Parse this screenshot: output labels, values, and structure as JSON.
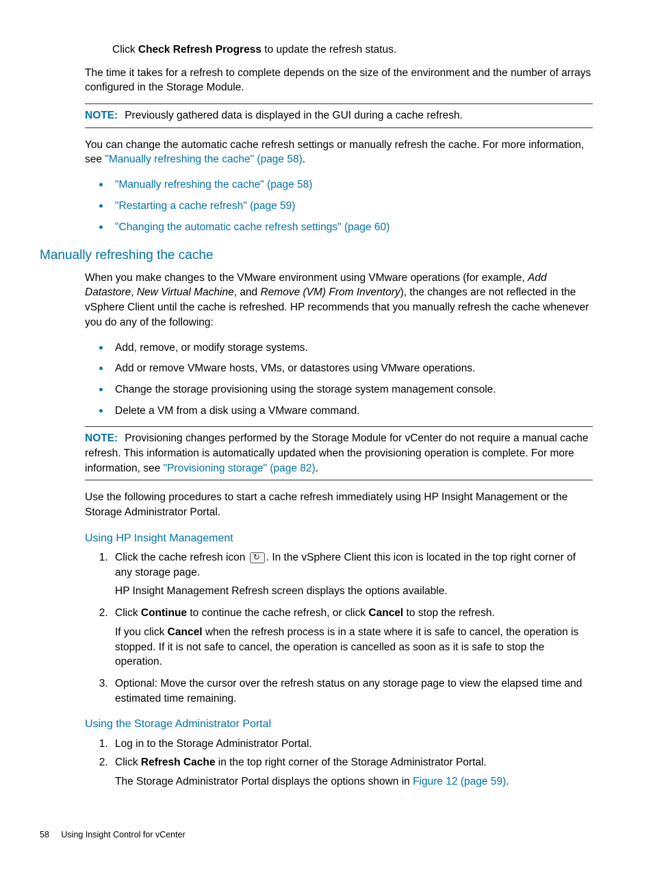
{
  "intro": {
    "click_prefix": "Click ",
    "click_bold": "Check Refresh Progress",
    "click_suffix": " to update the refresh status.",
    "time_para": "The time it takes for a refresh to complete depends on the size of the environment and the number of arrays configured in the Storage Module."
  },
  "note1": {
    "label": "NOTE:",
    "text": "Previously gathered data is displayed in the GUI during a cache refresh."
  },
  "after_note1": {
    "p_prefix": "You can change the automatic cache refresh settings or manually refresh the cache. For more information, see ",
    "p_link": "\"Manually refreshing the cache\" (page 58)",
    "p_suffix": "."
  },
  "toc": [
    "\"Manually refreshing the cache\" (page 58)",
    "\"Restarting a cache refresh\" (page 59)",
    "\"Changing the automatic cache refresh settings\" (page 60)"
  ],
  "section": {
    "title": "Manually refreshing the cache",
    "p1_a": "When you make changes to the VMware environment using VMware operations (for example, ",
    "p1_i1": "Add Datastore",
    "p1_b": ", ",
    "p1_i2": "New Virtual Machine",
    "p1_c": ", and ",
    "p1_i3": "Remove (VM) From Inventory",
    "p1_d": "), the changes are not reflected in the vSphere Client until the cache is refreshed. HP recommends that you manually refresh the cache whenever you do any of the following:",
    "bullets": [
      "Add, remove, or modify storage systems.",
      "Add or remove VMware hosts, VMs, or datastores using VMware operations.",
      "Change the storage provisioning using the storage system management console.",
      "Delete a VM from a disk using a VMware command."
    ]
  },
  "note2": {
    "label": "NOTE:",
    "t1": "Provisioning changes performed by the Storage Module for vCenter do not require a manual cache refresh. This information is automatically updated when the provisioning operation is complete. For more information, see ",
    "link": "\"Provisioning storage\" (page 82)",
    "t2": "."
  },
  "after_note2": "Use the following procedures to start a cache refresh immediately using HP Insight Management or the Storage Administrator Portal.",
  "sub1": {
    "title": "Using HP Insight Management",
    "s1a": "Click the cache refresh icon ",
    "s1b": ". In the vSphere Client this icon is located in the top right corner of any storage page.",
    "s1_follow": "HP Insight Management Refresh screen displays the options available.",
    "s2_a": "Click ",
    "s2_b1": "Continue",
    "s2_b": " to continue the cache refresh, or click ",
    "s2_b2": "Cancel",
    "s2_c": " to stop the refresh.",
    "s2_follow_a": "If you click ",
    "s2_follow_b": "Cancel",
    "s2_follow_c": " when the refresh process is in a state where it is safe to cancel, the operation is stopped. If it is not safe to cancel, the operation is cancelled as soon as it is safe to stop the operation.",
    "s3": "Optional: Move the cursor over the refresh status on any storage page to view the elapsed time and estimated time remaining."
  },
  "sub2": {
    "title": "Using the Storage Administrator Portal",
    "s1": "Log in to the Storage Administrator Portal.",
    "s2_a": "Click ",
    "s2_b": "Refresh Cache",
    "s2_c": " in the top right corner of the Storage Administrator Portal.",
    "s2_follow_a": "The Storage Administrator Portal displays the options shown in ",
    "s2_follow_link": "Figure 12 (page 59)",
    "s2_follow_b": "."
  },
  "footer": {
    "page": "58",
    "title": "Using Insight Control for vCenter"
  }
}
